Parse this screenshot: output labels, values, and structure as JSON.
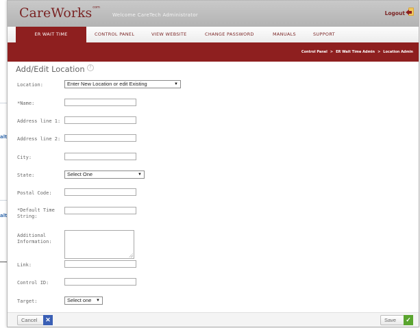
{
  "header": {
    "logo_text": "CareWorks",
    "logo_mark": "com",
    "welcome": "Welcome CareTech Administrator",
    "logout_label": "Logout"
  },
  "nav": {
    "items": [
      {
        "label": "ER WAIT TIME",
        "active": true
      },
      {
        "label": "CONTROL PANEL"
      },
      {
        "label": "VIEW WEBSITE"
      },
      {
        "label": "CHANGE PASSWORD"
      },
      {
        "label": "MANUALS"
      },
      {
        "label": "SUPPORT"
      }
    ]
  },
  "breadcrumb": [
    "Control Panel",
    "ER Wait Time Admin",
    "Location Admin"
  ],
  "page": {
    "title": "Add/Edit Location",
    "help_glyph": "?"
  },
  "form": {
    "location": {
      "label": "Location:",
      "value": "Enter New Location or edit Existing"
    },
    "name": {
      "label": "*Name:",
      "value": ""
    },
    "address1": {
      "label": "Address line 1:",
      "value": ""
    },
    "address2": {
      "label": "Address line 2:",
      "value": ""
    },
    "city": {
      "label": "City:",
      "value": ""
    },
    "state": {
      "label": "State:",
      "value": "Select One"
    },
    "postal": {
      "label": "Postal Code:",
      "value": ""
    },
    "default_time": {
      "label_line1": "*Default Time",
      "label_line2": "String:",
      "value": ""
    },
    "additional": {
      "label_line1": "Additional",
      "label_line2": "Information:",
      "value": ""
    },
    "link": {
      "label": "Link:",
      "value": ""
    },
    "control_id": {
      "label": "Control ID:",
      "value": ""
    },
    "target": {
      "label": "Target:",
      "value": "Select one"
    }
  },
  "footer": {
    "cancel_label": "Cancel",
    "save_label": "Save"
  },
  "background": {
    "fragment_1": "alt",
    "fragment_2": "alt"
  },
  "colors": {
    "brand_red": "#8e1f1f",
    "cancel_icon_bg": "#3a5fb5",
    "save_icon_bg": "#5aa52f"
  }
}
